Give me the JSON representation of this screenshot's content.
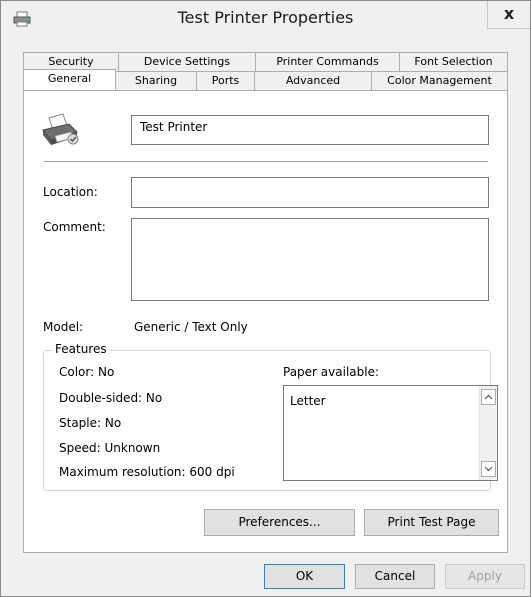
{
  "window": {
    "title": "Test Printer Properties",
    "close_label": "x"
  },
  "tabs": {
    "row1": [
      "Security",
      "Device Settings",
      "Printer Commands",
      "Font Selection"
    ],
    "row2": [
      "General",
      "Sharing",
      "Ports",
      "Advanced",
      "Color Management"
    ],
    "active": "General"
  },
  "general": {
    "printer_name": "Test Printer",
    "location_label": "Location:",
    "location_value": "",
    "comment_label": "Comment:",
    "comment_value": "",
    "model_label": "Model:",
    "model_value": "Generic / Text Only",
    "features": {
      "title": "Features",
      "color": "Color: No",
      "double_sided": "Double-sided: No",
      "staple": "Staple: No",
      "speed": "Speed: Unknown",
      "max_resolution": "Maximum resolution: 600 dpi",
      "paper_label": "Paper available:",
      "paper_items": [
        "Letter"
      ]
    },
    "preferences_button": "Preferences...",
    "print_test_button": "Print Test Page"
  },
  "footer": {
    "ok": "OK",
    "cancel": "Cancel",
    "apply": "Apply"
  },
  "colors": {
    "accent": "#3c7fb1",
    "face": "#f0f0f0",
    "button": "#e1e1e1"
  },
  "icons": [
    "printer-icon",
    "close-icon",
    "scroll-up-icon",
    "scroll-down-icon"
  ]
}
